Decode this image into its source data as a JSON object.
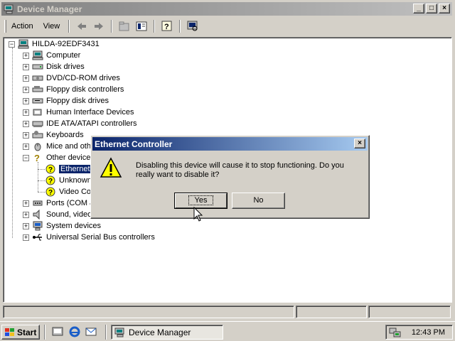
{
  "window": {
    "title": "Device Manager",
    "controls": [
      "_",
      "□",
      "×"
    ]
  },
  "menubar": {
    "action": "Action",
    "view": "View"
  },
  "toolbar": {
    "icons": [
      "back-icon",
      "forward-icon",
      "up-icon",
      "properties-icon",
      "help-icon",
      "scan-icon"
    ]
  },
  "tree": {
    "root": "HILDA-92EDF3431",
    "items": [
      {
        "label": "Computer",
        "icon": "computer-icon"
      },
      {
        "label": "Disk drives",
        "icon": "disk-icon"
      },
      {
        "label": "DVD/CD-ROM drives",
        "icon": "cdrom-icon"
      },
      {
        "label": "Floppy disk controllers",
        "icon": "floppy-controller-icon"
      },
      {
        "label": "Floppy disk drives",
        "icon": "floppy-icon"
      },
      {
        "label": "Human Interface Devices",
        "icon": "hid-icon"
      },
      {
        "label": "IDE ATA/ATAPI controllers",
        "icon": "ide-icon"
      },
      {
        "label": "Keyboards",
        "icon": "keyboard-icon"
      },
      {
        "label": "Mice and oth",
        "icon": "mouse-icon"
      },
      {
        "label": "Other device",
        "icon": "other-device-icon"
      }
    ],
    "other_children": [
      {
        "label": "Ethernet",
        "icon": "warning-device-icon"
      },
      {
        "label": "Unknown",
        "icon": "warning-device-icon"
      },
      {
        "label": "Video Co",
        "icon": "warning-device-icon"
      }
    ],
    "items_after": [
      {
        "label": "Ports (COM &",
        "icon": "port-icon"
      },
      {
        "label": "Sound, video",
        "icon": "sound-icon"
      },
      {
        "label": "System devices",
        "icon": "system-icon"
      },
      {
        "label": "Universal Serial Bus controllers",
        "icon": "usb-icon"
      }
    ]
  },
  "dialog": {
    "title": "Ethernet Controller",
    "message": "Disabling this device will cause it to stop functioning. Do you really want to disable it?",
    "yes_label": "Yes",
    "no_label": "No"
  },
  "taskbar": {
    "start_label": "Start",
    "task_label": "Device Manager",
    "clock": "12:43 PM"
  },
  "colors": {
    "titlebar_active": "#0a246a",
    "titlebar_inactive": "#808080",
    "selection": "#0a246a",
    "face": "#d4d0c8"
  }
}
